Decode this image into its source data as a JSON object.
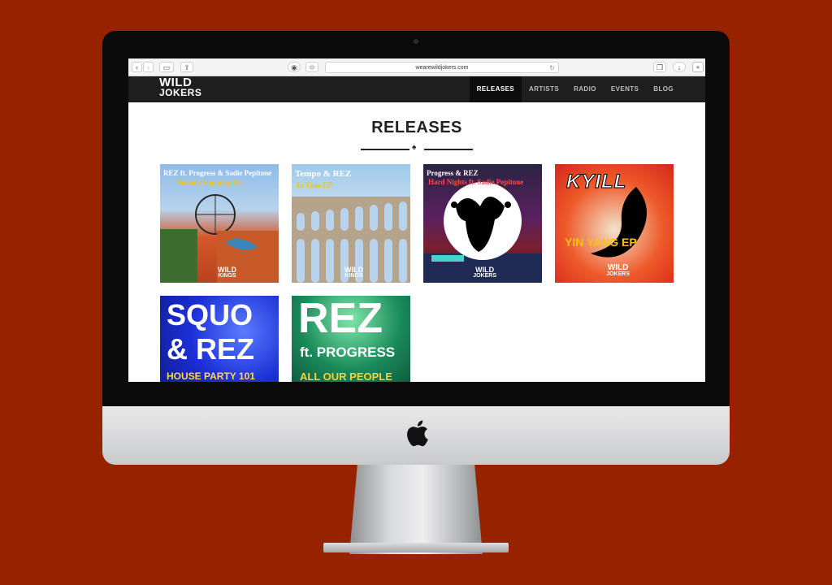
{
  "browser": {
    "url": "wearewildjokers.com"
  },
  "site": {
    "logo_line1": "WILD",
    "logo_line2": "JOKERS",
    "nav": [
      {
        "label": "RELEASES",
        "active": true
      },
      {
        "label": "ARTISTS",
        "active": false
      },
      {
        "label": "RADIO",
        "active": false
      },
      {
        "label": "EVENTS",
        "active": false
      },
      {
        "label": "BLOG",
        "active": false
      }
    ]
  },
  "page": {
    "title": "RELEASES"
  },
  "releases": [
    {
      "line1": "REZ ft. Progress & Sadie Pepitone",
      "line2": "Nobody Stopping Me",
      "badge1": "WILD",
      "badge2": "KINGS"
    },
    {
      "line1": "Tempo & REZ",
      "line2": "In Time EP",
      "badge1": "WILD",
      "badge2": "KINGS"
    },
    {
      "line1": "Progress & REZ",
      "line2": "Hard Nights ft. Sadie Pepitone",
      "badge1": "WILD",
      "badge2": "JOKERS"
    },
    {
      "line1": "KYILL",
      "line2": "YIN YANG EP",
      "badge1": "WILD",
      "badge2": "JOKERS"
    },
    {
      "line1": "SQUO",
      "line2": "& REZ",
      "line3": "HOUSE PARTY 101"
    },
    {
      "line1": "REZ",
      "line2": "ft. PROGRESS",
      "line3": "ALL OUR PEOPLE"
    }
  ],
  "colors": {
    "background": "#962200",
    "nav_bg": "#1e1e1e",
    "accent_yellow": "#f2c31c"
  }
}
